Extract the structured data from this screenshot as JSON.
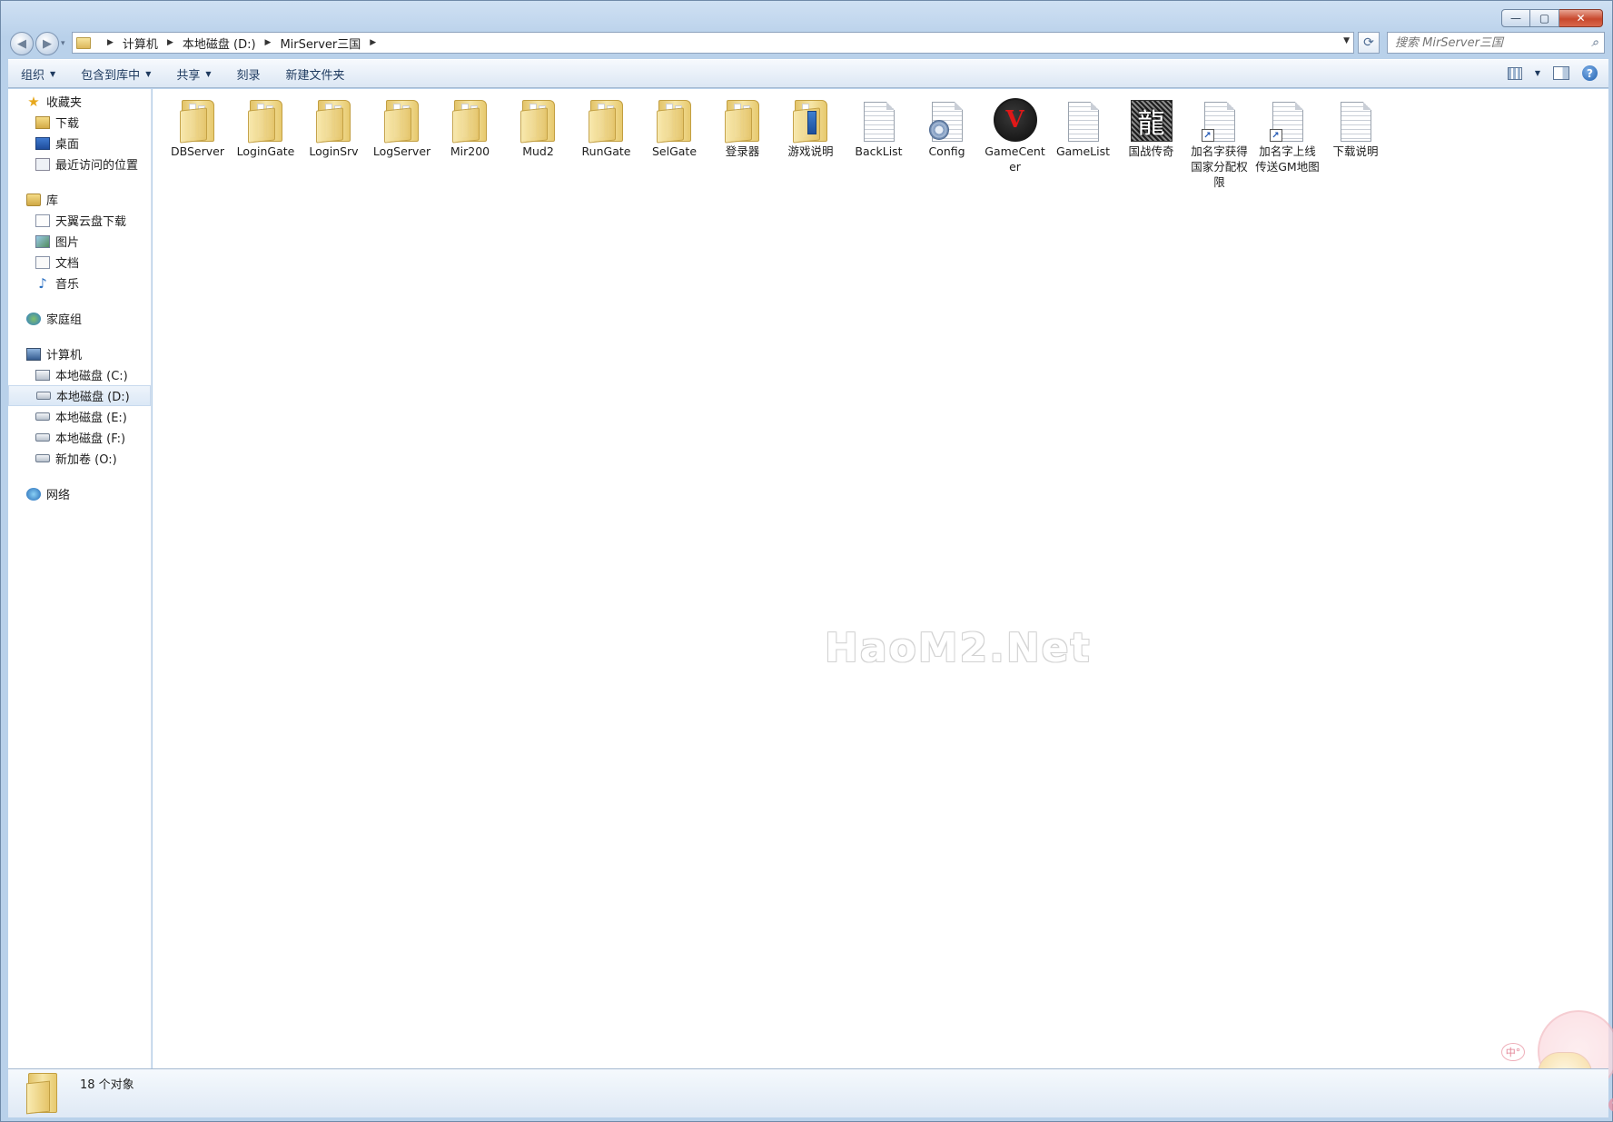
{
  "window": {
    "buttons": {
      "minimize": "—",
      "maximize": "▢",
      "close": "✕"
    }
  },
  "navigation": {
    "back_icon": "back-arrow-icon",
    "forward_icon": "forward-arrow-icon",
    "history_glyph": "▾",
    "breadcrumb": [
      "计算机",
      "本地磁盘 (D:)",
      "MirServer三国"
    ],
    "separator": "▶",
    "dropdown_glyph": "▼",
    "refresh_glyph": "⟳",
    "search_placeholder": "搜索 MirServer三国",
    "search_glyph": "⌕"
  },
  "toolbar": {
    "organize": "组织",
    "include_library": "包含到库中",
    "share": "共享",
    "burn": "刻录",
    "new_folder": "新建文件夹",
    "caret": "▼",
    "views_caret": "▼",
    "help": "?"
  },
  "sidebar": {
    "favorites": {
      "label": "收藏夹",
      "items": [
        "下载",
        "桌面",
        "最近访问的位置"
      ]
    },
    "libraries": {
      "label": "库",
      "items": [
        "天翼云盘下载",
        "图片",
        "文档",
        "音乐"
      ]
    },
    "homegroup": {
      "label": "家庭组"
    },
    "computer": {
      "label": "计算机",
      "items": [
        "本地磁盘 (C:)",
        "本地磁盘 (D:)",
        "本地磁盘 (E:)",
        "本地磁盘 (F:)",
        "新加卷 (O:)"
      ],
      "selected": "本地磁盘 (D:)"
    },
    "network": {
      "label": "网络"
    },
    "star_glyph": "★",
    "music_glyph": "♪"
  },
  "files": [
    {
      "name": "DBServer",
      "type": "folder"
    },
    {
      "name": "LoginGate",
      "type": "folder"
    },
    {
      "name": "LoginSrv",
      "type": "folder"
    },
    {
      "name": "LogServer",
      "type": "folder"
    },
    {
      "name": "Mir200",
      "type": "folder"
    },
    {
      "name": "Mud2",
      "type": "folder"
    },
    {
      "name": "RunGate",
      "type": "folder"
    },
    {
      "name": "SelGate",
      "type": "folder"
    },
    {
      "name": "登录器",
      "type": "folder"
    },
    {
      "name": "游戏说明",
      "type": "folder-book"
    },
    {
      "name": "BackList",
      "type": "text"
    },
    {
      "name": "Config",
      "type": "config"
    },
    {
      "name": "GameCenter",
      "type": "exe-gamecenter"
    },
    {
      "name": "GameList",
      "type": "text"
    },
    {
      "name": "国战传奇",
      "type": "exe-dragon"
    },
    {
      "name": "加名字获得国家分配权限",
      "type": "shortcut"
    },
    {
      "name": "加名字上线传送GM地图",
      "type": "shortcut"
    },
    {
      "name": "下载说明",
      "type": "text"
    }
  ],
  "icons": {
    "gamecenter_glyph": "V",
    "dragon_glyph": "龍",
    "shortcut_glyph": "↗"
  },
  "watermark": "HaoM2.Net",
  "mascot": {
    "bubble": "中°",
    "heart": "♥"
  },
  "status": {
    "count": "18 个对象"
  }
}
